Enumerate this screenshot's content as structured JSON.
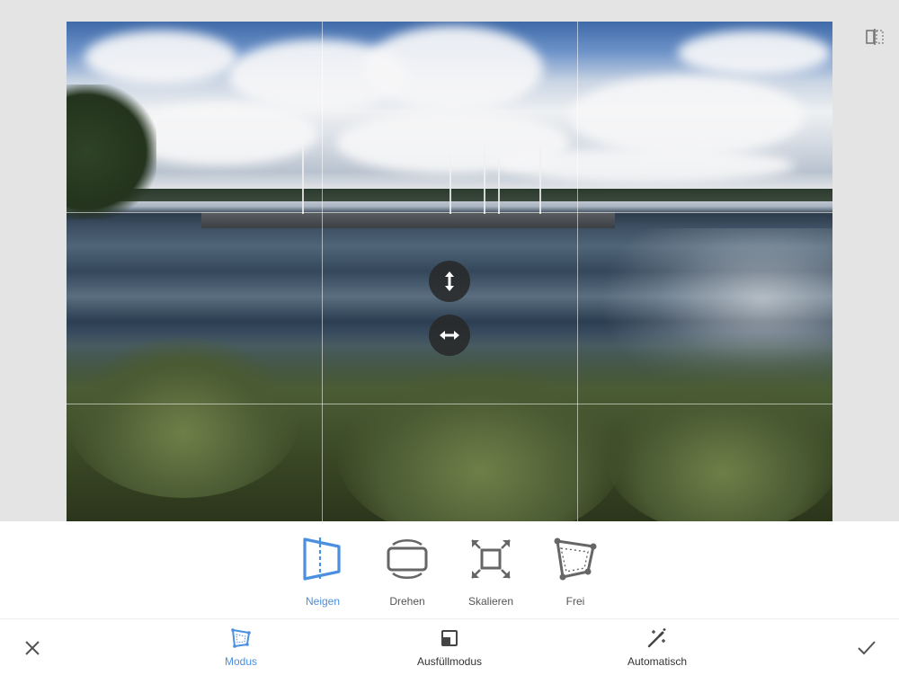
{
  "tools": [
    {
      "id": "neigen",
      "label": "Neigen",
      "icon": "tilt-icon",
      "active": true
    },
    {
      "id": "drehen",
      "label": "Drehen",
      "icon": "rotate-icon",
      "active": false
    },
    {
      "id": "skalieren",
      "label": "Skalieren",
      "icon": "scale-icon",
      "active": false
    },
    {
      "id": "frei",
      "label": "Frei",
      "icon": "free-transform-icon",
      "active": false
    }
  ],
  "tabs": [
    {
      "id": "modus",
      "label": "Modus",
      "icon": "mode-icon",
      "active": true
    },
    {
      "id": "ausfuellmodus",
      "label": "Ausfüllmodus",
      "icon": "fill-mode-icon",
      "active": false
    },
    {
      "id": "automatisch",
      "label": "Automatisch",
      "icon": "magic-wand-icon",
      "active": false
    }
  ],
  "icons": {
    "cancel": "close-icon",
    "apply": "checkmark-icon",
    "compare": "compare-icon",
    "vertical_handle": "vertical-arrows-icon",
    "horizontal_handle": "horizontal-arrows-icon"
  },
  "colors": {
    "accent": "#4a8fe0",
    "inactive": "#555555",
    "handle_bg": "#282828"
  }
}
